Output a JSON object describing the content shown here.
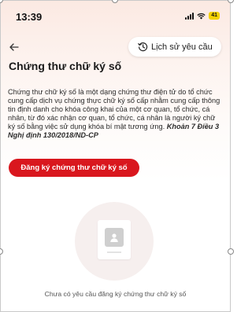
{
  "status_bar": {
    "time": "13:39",
    "battery": "41"
  },
  "header": {
    "back_icon": "arrow-left-icon",
    "history_icon": "history-clock-icon",
    "history_label": "Lịch sử yêu cầu"
  },
  "page": {
    "title": "Chứng thư chữ ký số",
    "description": "Chứng thư chữ ký số là một dạng chứng thư điện tử do tổ chức cung cấp dịch vụ chứng thực chữ ký số cấp nhằm cung cấp thông tin định danh cho khóa công khai của một cơ quan, tổ chức, cá nhân, từ đó xác nhận cơ quan, tổ chức, cá nhân là người ký chữ ký số bằng việc sử dụng khóa bí mật tương ứng.",
    "legal_reference": "Khoản 7 Điều 3 Nghị định 130/2018/ND-CP",
    "register_button": "Đăng ký chứng thư chữ ký số"
  },
  "empty_state": {
    "illustration_icon": "document-avatar-icon",
    "message": "Chưa có yêu cầu đăng ký chứng thư chữ ký số"
  },
  "colors": {
    "accent": "#d9171e",
    "battery": "#f4d200",
    "header_gradient_top": "#fbe9e2"
  }
}
